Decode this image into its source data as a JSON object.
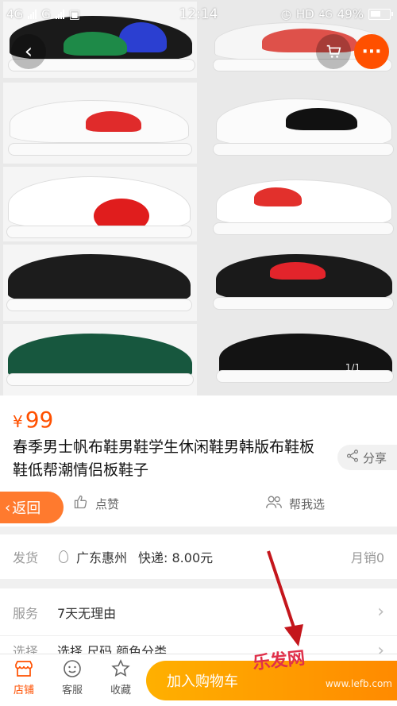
{
  "status": {
    "net1": "4G",
    "net2": "G",
    "time": "12:14",
    "hd": "HD",
    "net3": "4G",
    "battery": "49%"
  },
  "photo": {
    "pager": "1/1"
  },
  "product": {
    "price_symbol": "¥",
    "price": "99",
    "title": "春季男士帆布鞋男鞋学生休闲鞋男韩版布鞋板鞋低帮潮情侣板鞋子",
    "share_label": "分享"
  },
  "actions": {
    "back_label": "返回",
    "like_label": "点赞",
    "help_label": "帮我选"
  },
  "shipping": {
    "label": "发货",
    "location": "广东惠州",
    "fee": "快递: 8.00元",
    "sales": "月销0"
  },
  "service": {
    "label": "服务",
    "value": "7天无理由"
  },
  "select": {
    "label": "选择",
    "value": "选择 尺码 颜色分类"
  },
  "bottom": {
    "shop": "店铺",
    "cs": "客服",
    "fav": "收藏",
    "add_cart": "加入购物车"
  },
  "watermark": {
    "main": "乐发网",
    "sub": "www.lefb.com"
  },
  "colors": {
    "accent": "#ff5000",
    "cart_gradient": "#ff9a00"
  }
}
